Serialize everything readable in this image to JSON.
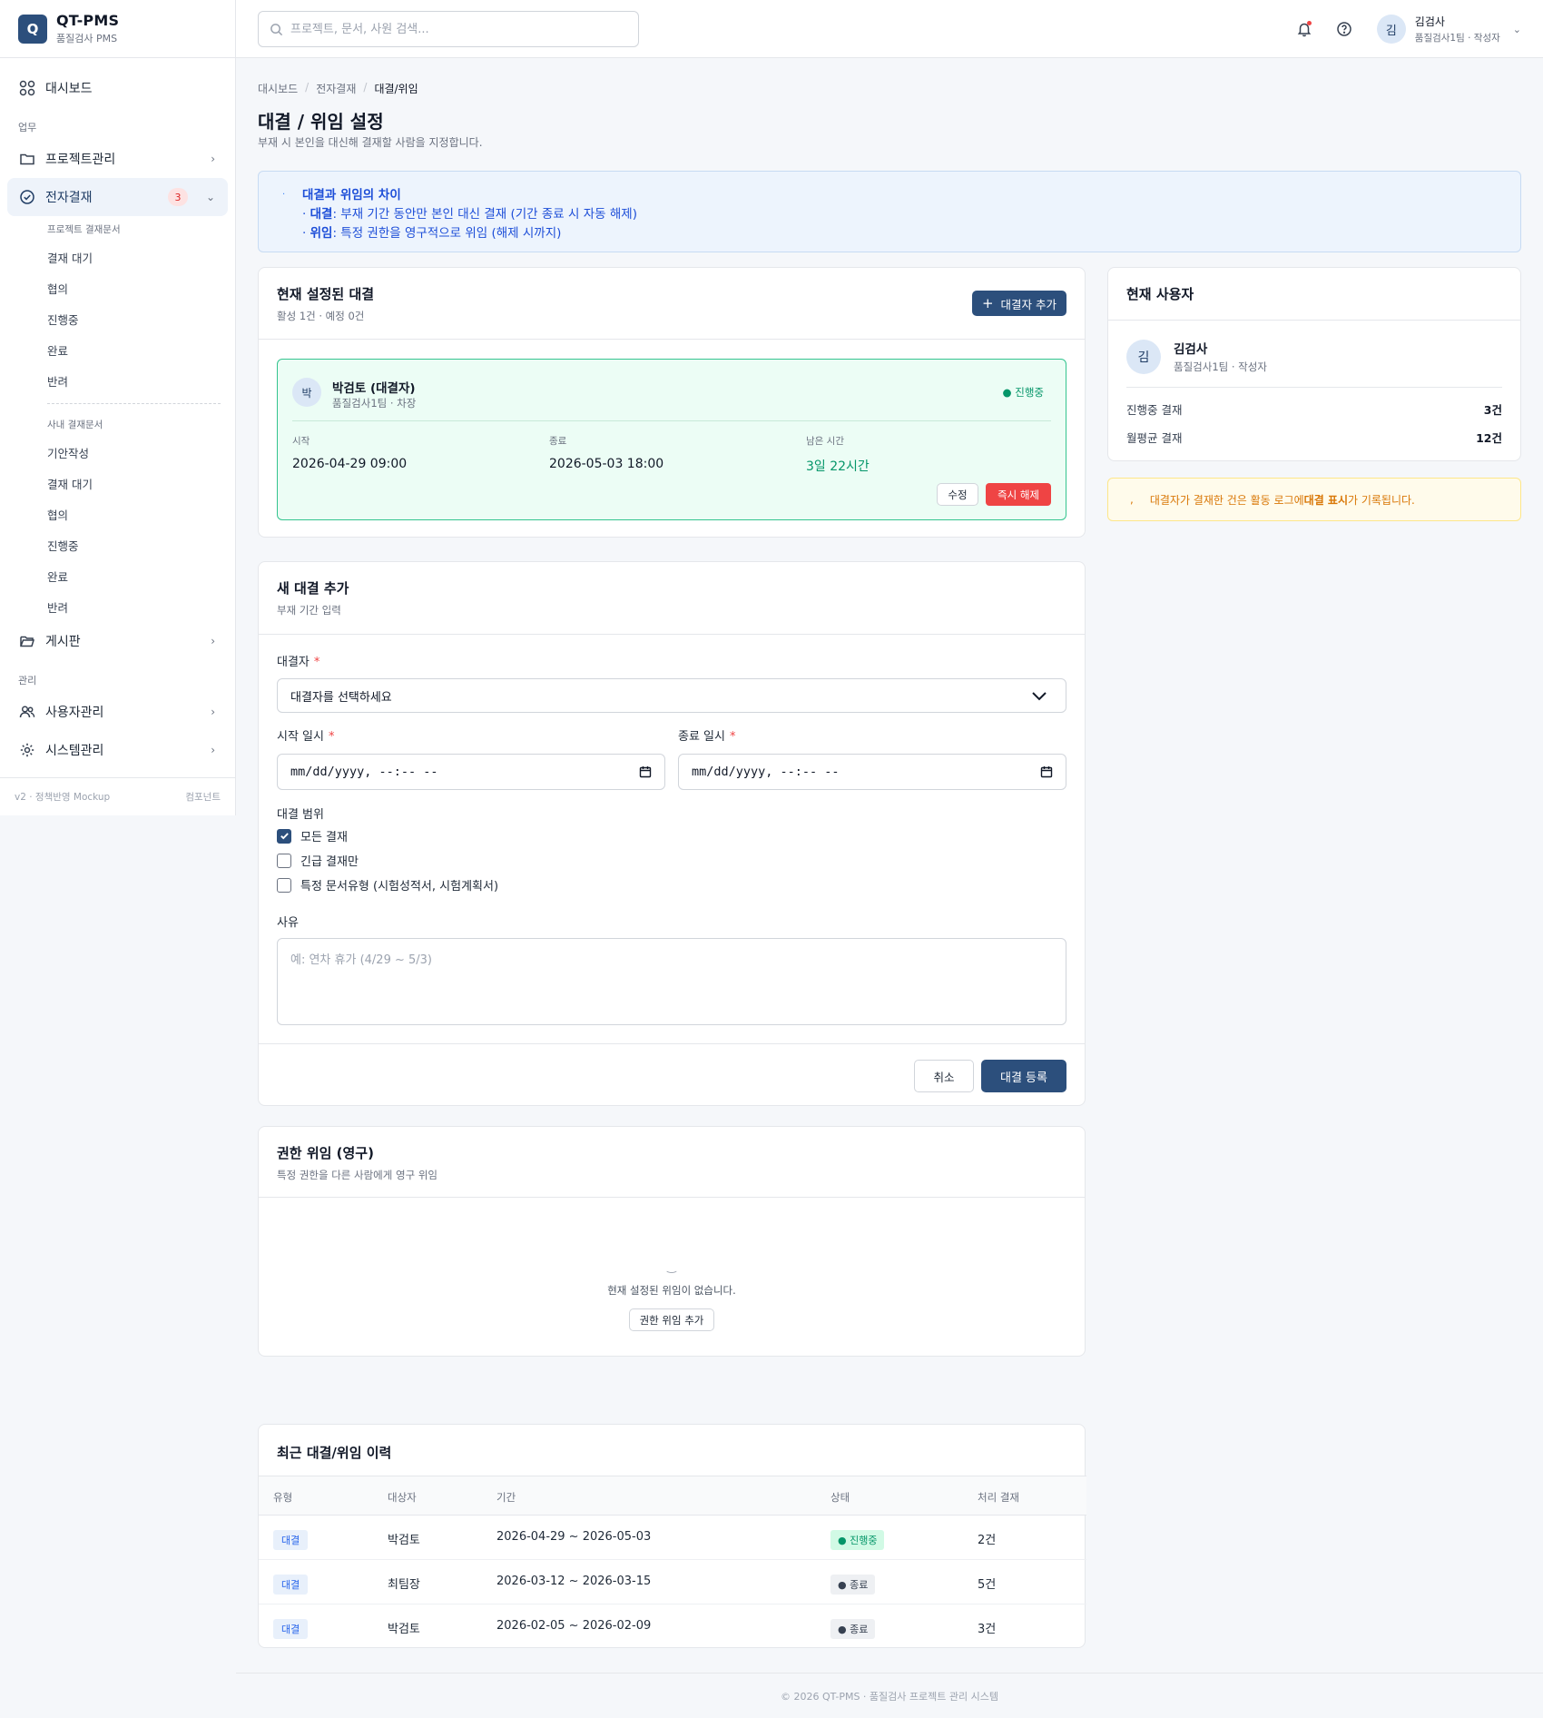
{
  "brand": {
    "logo_letter": "Q",
    "title": "QT-PMS",
    "subtitle": "품질검사 PMS"
  },
  "sidebar": {
    "dashboard": "대시보드",
    "section_work": "업무",
    "projects": "프로젝트관리",
    "approval": "전자결재",
    "approval_badge": "3",
    "project_docs_title": "프로젝트 결재문서",
    "project_docs": [
      "결재 대기",
      "협의",
      "진행중",
      "완료",
      "반려"
    ],
    "internal_docs_title": "사내 결재문서",
    "internal_docs": [
      "기안작성",
      "결재 대기",
      "협의",
      "진행중",
      "완료",
      "반려"
    ],
    "board": "게시판",
    "section_admin": "관리",
    "users": "사용자관리",
    "system": "시스템관리",
    "footer_left": "v2 · 정책반영 Mockup",
    "footer_right": "컴포넌트"
  },
  "topbar": {
    "search_placeholder": "프로젝트, 문서, 사원 검색...",
    "user_avatar": "김",
    "user_name": "김검사",
    "user_sub": "품질검사1팀 · 작성자"
  },
  "page": {
    "breadcrumb": [
      "대시보드",
      "전자결재",
      "대결/위임"
    ],
    "title": "대결 / 위임 설정",
    "desc": "부재 시 본인을 대신해 결재할 사람을 지정합니다."
  },
  "info": {
    "title": "대결과 위임의 차이",
    "line1_key": "대결",
    "line1_text": ": 부재 기간 동안만 본인 대신 결재 (기간 종료 시 자동 해제)",
    "line2_key": "위임",
    "line2_text": ": 특정 권한을 영구적으로 위임 (해제 시까지)"
  },
  "current_proxy": {
    "title": "현재 설정된 대결",
    "sub": "활성 1건 · 예정 0건",
    "add_button": "대결자 추가",
    "avatar": "박",
    "name": "박검토 (대결자)",
    "role": "품질검사1팀 · 차장",
    "status": "진행중",
    "start_label": "시작",
    "start_value": "2026-04-29 09:00",
    "end_label": "종료",
    "end_value": "2026-05-03 18:00",
    "remain_label": "남은 시간",
    "remain_value": "3일 22시간",
    "edit_button": "수정",
    "release_button": "즉시 해제"
  },
  "user_card": {
    "title": "현재 사용자",
    "avatar": "김",
    "name": "김검사",
    "role": "품질검사1팀 · 작성자",
    "stat1_label": "진행중 결재",
    "stat1_value": "3건",
    "stat2_label": "월평균 결재",
    "stat2_value": "12건"
  },
  "warning": {
    "prefix": "대결자가 결재한 건은 활동 로그에 ",
    "bold": "대결 표시",
    "suffix": "가 기록됩니다."
  },
  "new_proxy": {
    "title": "새 대결 추가",
    "sub": "부재 기간 입력",
    "proxy_label": "대결자",
    "proxy_select": "대결자를 선택하세요",
    "start_label": "시작 일시",
    "end_label": "종료 일시",
    "date_placeholder": "mm/dd/yyyy, --:-- --",
    "scope_label": "대결 범위",
    "scope_options": [
      "모든 결재",
      "긴급 결재만",
      "특정 문서유형 (시험성적서, 시험계획서)"
    ],
    "reason_label": "사유",
    "reason_placeholder": "예: 연차 휴가 (4/29 ~ 5/3)",
    "cancel_button": "취소",
    "submit_button": "대결 등록"
  },
  "delegation": {
    "title": "권한 위임 (영구)",
    "sub": "특정 권한을 다른 사람에게 영구 위임",
    "empty_text": "현재 설정된 위임이 없습니다.",
    "add_button": "권한 위임 추가"
  },
  "history": {
    "title": "최근 대결/위임 이력",
    "columns": [
      "유형",
      "대상자",
      "기간",
      "상태",
      "처리 결재"
    ],
    "rows": [
      {
        "type": "대결",
        "target": "박검토",
        "period": "2026-04-29 ~ 2026-05-03",
        "status": "진행중",
        "count": "2건"
      },
      {
        "type": "대결",
        "target": "최팀장",
        "period": "2026-03-12 ~ 2026-03-15",
        "status": "종료",
        "count": "5건"
      },
      {
        "type": "대결",
        "target": "박검토",
        "period": "2026-02-05 ~ 2026-02-09",
        "status": "종료",
        "count": "3건"
      }
    ]
  },
  "footer": "© 2026 QT-PMS · 품질검사 프로젝트 관리 시스템"
}
